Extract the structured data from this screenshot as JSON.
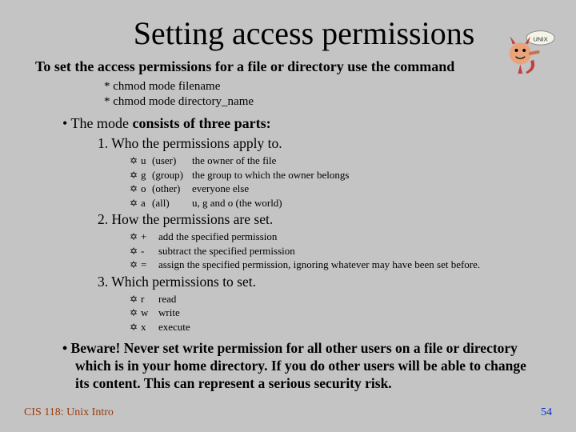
{
  "title": "Setting access permissions",
  "intro": "To set the access permissions for a file or directory use the command",
  "commands": [
    "chmod mode filename",
    "chmod mode directory_name"
  ],
  "mode_line_lead": "The mode ",
  "mode_line_bold": "consists of three parts:",
  "sections": [
    {
      "num": "1.",
      "head": "Who the permissions apply to.",
      "rows": [
        {
          "code": "u",
          "paren": "(user)",
          "desc": "the owner of the file"
        },
        {
          "code": "g",
          "paren": "(group)",
          "desc": "the group to which the owner belongs"
        },
        {
          "code": "o",
          "paren": "(other)",
          "desc": "everyone else"
        },
        {
          "code": "a",
          "paren": "(all)",
          "desc": "u, g and o (the world)"
        }
      ]
    },
    {
      "num": "2.",
      "head": "How the permissions are set.",
      "rows": [
        {
          "code": "+",
          "paren": "",
          "desc": "add the specified permission"
        },
        {
          "code": "-",
          "paren": "",
          "desc": "subtract the specified permission"
        },
        {
          "code": "=",
          "paren": "",
          "desc": "assign the specified permission, ignoring whatever may have been set before."
        }
      ]
    },
    {
      "num": "3.",
      "head": "Which permissions to set.",
      "rows": [
        {
          "code": "r",
          "paren": "",
          "desc": "read"
        },
        {
          "code": "w",
          "paren": "",
          "desc": "write"
        },
        {
          "code": "x",
          "paren": "",
          "desc": "execute"
        }
      ]
    }
  ],
  "beware": "Beware!  Never set write permission for all other users on a file or directory which is in your home directory. If you do other users will be able to change its content. This can represent a serious security risk.",
  "footer_left": "CIS 118: Unix Intro",
  "footer_right": "54"
}
